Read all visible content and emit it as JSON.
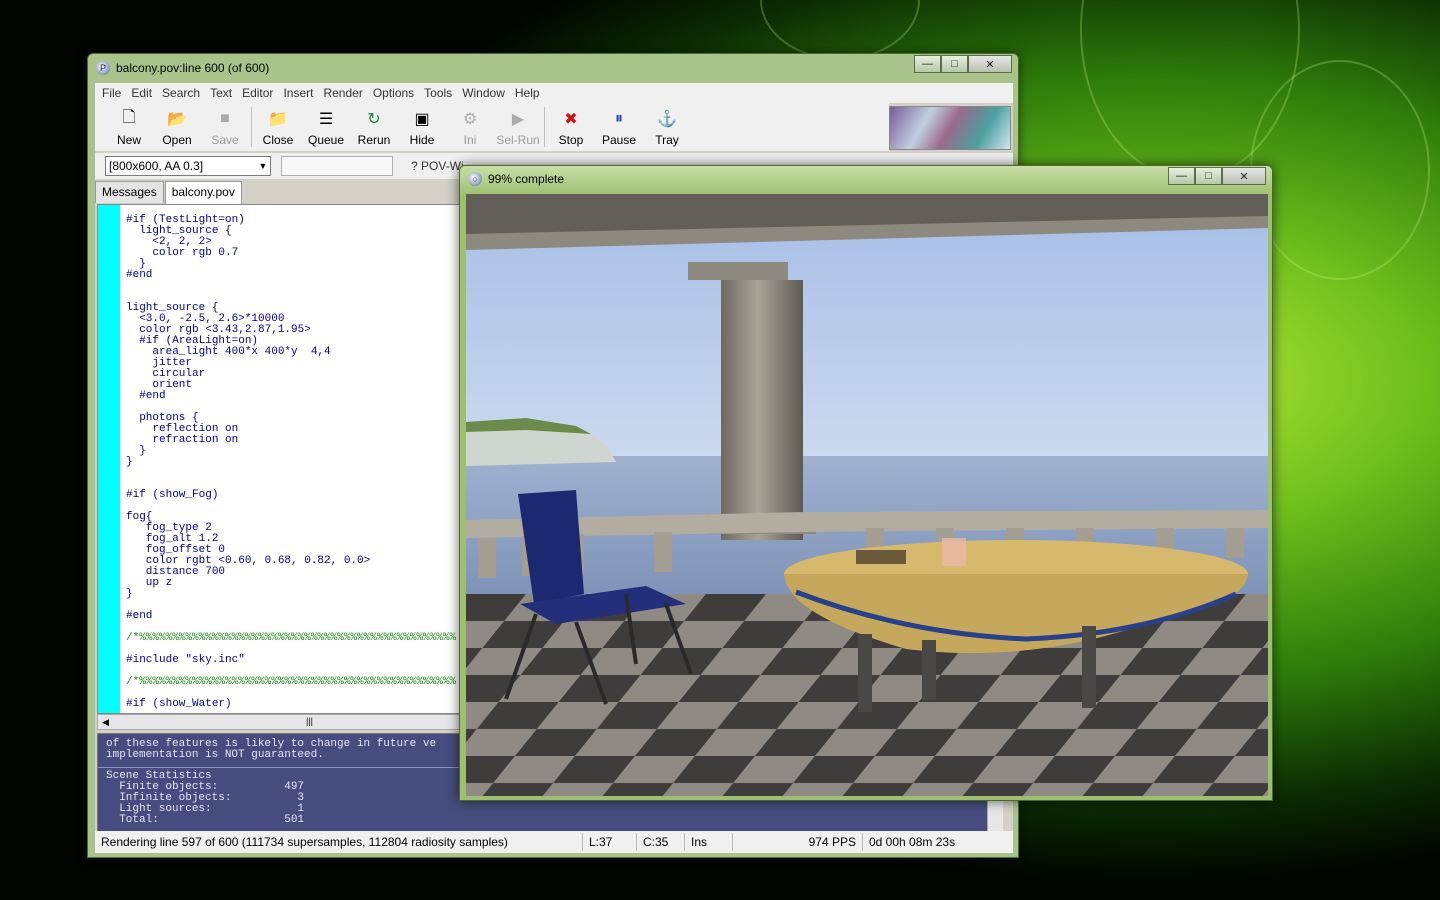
{
  "main_window": {
    "title": "balcony.pov:line 600 (of 600)",
    "menu": [
      "File",
      "Edit",
      "Search",
      "Text",
      "Editor",
      "Insert",
      "Render",
      "Options",
      "Tools",
      "Window",
      "Help"
    ],
    "toolbar": [
      {
        "label": "New",
        "icon": "new-file-icon",
        "enabled": true
      },
      {
        "label": "Open",
        "icon": "open-folder-icon",
        "enabled": true
      },
      {
        "label": "Save",
        "icon": "save-icon",
        "enabled": false
      },
      {
        "label": "Close",
        "icon": "close-file-icon",
        "enabled": true
      },
      {
        "label": "Queue",
        "icon": "queue-icon",
        "enabled": true
      },
      {
        "label": "Rerun",
        "icon": "rerun-icon",
        "enabled": true
      },
      {
        "label": "Hide",
        "icon": "hide-icon",
        "enabled": true
      },
      {
        "label": "Ini",
        "icon": "ini-icon",
        "enabled": false
      },
      {
        "label": "Sel-Run",
        "icon": "sel-run-icon",
        "enabled": false
      },
      {
        "label": "Stop",
        "icon": "stop-icon",
        "enabled": true
      },
      {
        "label": "Pause",
        "icon": "pause-icon",
        "enabled": true
      },
      {
        "label": "Tray",
        "icon": "tray-icon",
        "enabled": true
      }
    ],
    "resolution_combo": "[800x600, AA 0.3]",
    "help_buttons_partial": "? POV-Wi",
    "tabs": [
      "Messages",
      "balcony.pov"
    ],
    "active_tab": "balcony.pov",
    "code_lines": [
      "#if (TestLight=on)",
      "  light_source {",
      "    <2, 2, 2>",
      "    color rgb 0.7",
      "  }",
      "#end",
      "",
      "",
      "light_source {",
      "  <3.0, -2.5, 2.6>*10000",
      "  color rgb <3.43,2.87,1.95>",
      "  #if (AreaLight=on)",
      "    area_light 400*x 400*y  4,4",
      "    jitter",
      "    circular",
      "    orient",
      "  #end",
      "",
      "  photons {",
      "    reflection on",
      "    refraction on",
      "  }",
      "}",
      "",
      "",
      "#if (show_Fog)",
      "",
      "fog{",
      "   fog_type 2",
      "   fog_alt 1.2",
      "   fog_offset 0",
      "   color rgbt <0.60, 0.68, 0.82, 0.0>",
      "   distance 700",
      "   up z",
      "}",
      "",
      "#end",
      "",
      "/*%%%%%%%%%%%%%%%%%%%%%%%%%%%%%%%%%%%%%%%%%%%%%%%%",
      "",
      "#include \"sky.inc\"",
      "",
      "/*%%%%%%%%%%%%%%%%%%%%%%%%%%%%%%%%%%%%%%%%%%%%%%%%",
      "",
      "#if (show_Water)"
    ],
    "messages_top": "of these features is likely to change in future ve\nimplementation is NOT guaranteed.",
    "messages_bottom": "Scene Statistics\n  Finite objects:          497\n  Infinite objects:          3\n  Light sources:             1\n  Total:                   501",
    "status": {
      "message": "Rendering line 597 of 600 (111734 supersamples, 112804 radiosity samples)",
      "line": "L:37",
      "col": "C:35",
      "mode": "Ins",
      "pps": "974 PPS",
      "elapsed": "0d 00h 08m 23s"
    }
  },
  "render_window": {
    "title": "99% complete"
  },
  "colors": {
    "gutter": "#00ffff",
    "message_pane": "#464d7e",
    "keyword": "#00008b",
    "number": "#cc0066",
    "comment": "#228b22",
    "string": "#cc0000"
  }
}
